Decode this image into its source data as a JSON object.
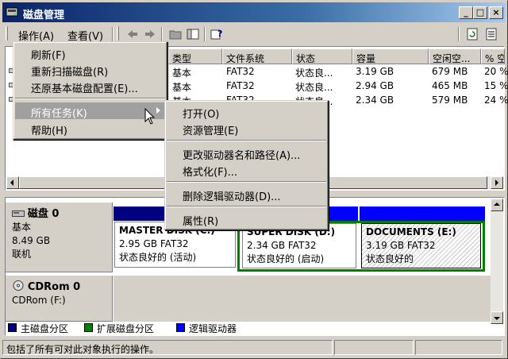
{
  "window": {
    "title": "磁盘管理"
  },
  "menubar": {
    "action": "操作(A)",
    "view": "查看(V)"
  },
  "action_menu": {
    "items": [
      {
        "label": "刷新(F)"
      },
      {
        "label": "重新扫描磁盘(R)"
      },
      {
        "label": "还原基本磁盘配置(E)..."
      },
      {
        "label": "所有任务(K)",
        "submenu": true
      },
      {
        "label": "帮助(H)"
      }
    ]
  },
  "submenu": {
    "items": [
      {
        "label": "打开(O)"
      },
      {
        "label": "资源管理(E)"
      },
      {
        "label": "更改驱动器名和路径(A)..."
      },
      {
        "label": "格式化(F)..."
      },
      {
        "label": "删除逻辑驱动器(D)..."
      },
      {
        "label": "属性(R)"
      }
    ]
  },
  "volume_list": {
    "columns": [
      "类型",
      "文件系统",
      "状态",
      "容量",
      "空闲空...",
      "% 空"
    ],
    "rows": [
      [
        "基本",
        "FAT32",
        "状态良...",
        "3.19 GB",
        "679 MB",
        "20 %"
      ],
      [
        "基本",
        "FAT32",
        "状态良...",
        "2.94 GB",
        "465 MB",
        "15 %"
      ],
      [
        "基本",
        "FAT32",
        "状态良...",
        "2.34 GB",
        "579 MB",
        "24 %"
      ]
    ]
  },
  "disks": [
    {
      "name": "磁盘 0",
      "type": "基本",
      "size": "8.49 GB",
      "status": "联机",
      "partitions": [
        {
          "name": "MASTER DISK (C:)",
          "info": "2.95 GB FAT32",
          "status": "状态良好的 (活动)"
        },
        {
          "name": "SUPER DISK (D:)",
          "info": "2.34 GB FAT32",
          "status": "状态良好的 (启动)"
        },
        {
          "name": "DOCUMENTS  (E:)",
          "info": "3.19 GB FAT32",
          "status": "状态良好的"
        }
      ]
    },
    {
      "name": "CDRom 0",
      "type": "CDRom (F:)"
    }
  ],
  "legend": [
    {
      "label": "主磁盘分区",
      "color": "#000080"
    },
    {
      "label": "扩展磁盘分区",
      "color": "#008000"
    },
    {
      "label": "逻辑驱动器",
      "color": "#0000ff"
    }
  ],
  "status": {
    "text": "包括了所有可对此对象执行的操作。"
  },
  "colors": {
    "primary": "#000080",
    "extended": "#008000",
    "logical": "#0000ff",
    "highlight": "#0a246a"
  }
}
